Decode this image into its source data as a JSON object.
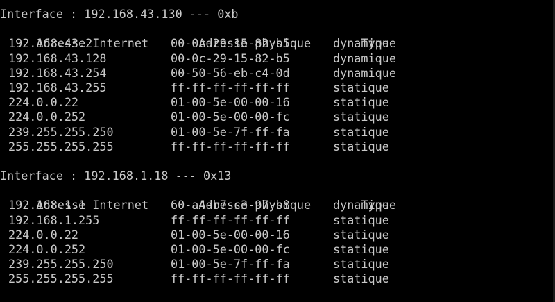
{
  "interfaces": [
    {
      "title": "Interface : 192.168.43.130 --- 0xb",
      "headers": [
        "Adresse Internet",
        "Adresse physique",
        "Type"
      ],
      "rows": [
        [
          "192.168.43.2",
          "00-0c-29-15-82-b5",
          "dynamique"
        ],
        [
          "192.168.43.128",
          "00-0c-29-15-82-b5",
          "dynamique"
        ],
        [
          "192.168.43.254",
          "00-50-56-eb-c4-0d",
          "dynamique"
        ],
        [
          "192.168.43.255",
          "ff-ff-ff-ff-ff-ff",
          "statique"
        ],
        [
          "224.0.0.22",
          "01-00-5e-00-00-16",
          "statique"
        ],
        [
          "224.0.0.252",
          "01-00-5e-00-00-fc",
          "statique"
        ],
        [
          "239.255.255.250",
          "01-00-5e-7f-ff-fa",
          "statique"
        ],
        [
          "255.255.255.255",
          "ff-ff-ff-ff-ff-ff",
          "statique"
        ]
      ]
    },
    {
      "title": "Interface : 192.168.1.18 --- 0x13",
      "headers": [
        "Adresse Internet",
        "Adresse physique",
        "Type"
      ],
      "rows": [
        [
          "192.168.1.1",
          "60-a4-b7-c3-97-b8",
          "dynamique"
        ],
        [
          "192.168.1.255",
          "ff-ff-ff-ff-ff-ff",
          "statique"
        ],
        [
          "224.0.0.22",
          "01-00-5e-00-00-16",
          "statique"
        ],
        [
          "224.0.0.252",
          "01-00-5e-00-00-fc",
          "statique"
        ],
        [
          "239.255.255.250",
          "01-00-5e-7f-ff-fa",
          "statique"
        ],
        [
          "255.255.255.255",
          "ff-ff-ff-ff-ff-ff",
          "statique"
        ]
      ]
    }
  ]
}
